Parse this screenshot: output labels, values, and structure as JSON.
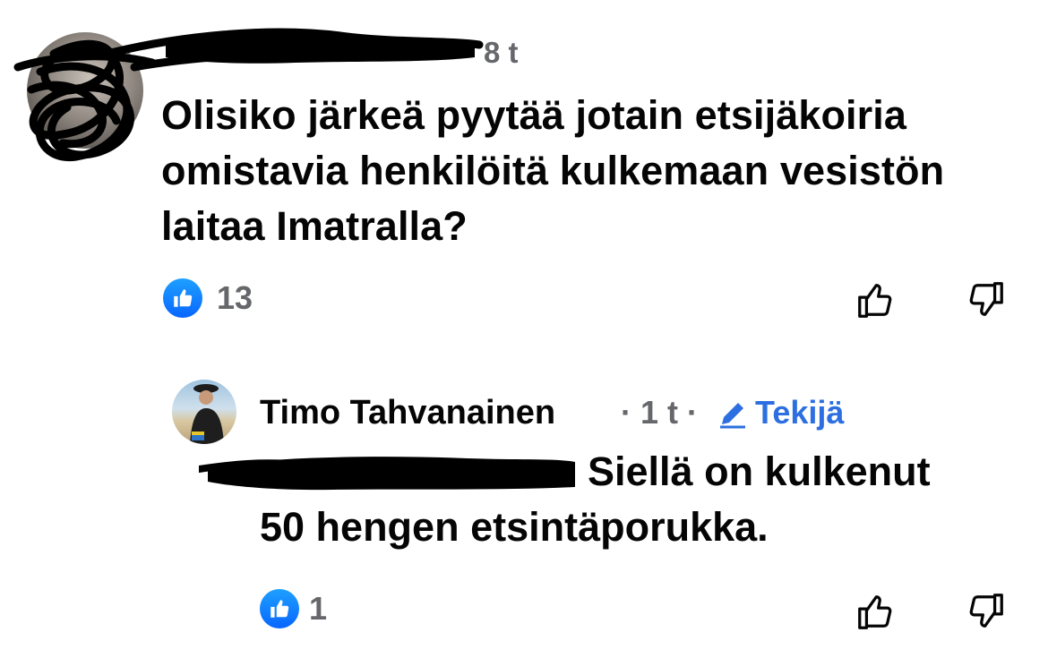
{
  "comment": {
    "author_hidden": true,
    "timestamp": "8 t",
    "text": "Olisiko järkeä pyytää jotain etsijäkoiria omistavia henkilöitä kulkemaan vesistön laitaa Imatralla?",
    "likes": "13",
    "icons": {
      "reaction": "thumbs-up-badge-icon",
      "like": "thumbs-up-outline-icon",
      "dislike": "thumbs-down-outline-icon"
    }
  },
  "reply": {
    "author": "Timo Tahvanainen",
    "meta": "· 1 t ·",
    "author_badge": "Tekijä",
    "mention_hidden": true,
    "text_line1": "Siellä on kulkenut",
    "text_line2": "50 hengen etsintäporukka.",
    "likes": "1",
    "icons": {
      "badge": "pencil-icon",
      "reaction": "thumbs-up-badge-icon",
      "like": "thumbs-up-outline-icon",
      "dislike": "thumbs-down-outline-icon"
    }
  },
  "colors": {
    "text": "#050505",
    "secondary": "#65676b",
    "accent": "#2d6fe0",
    "like_badge": "#0866ff",
    "redaction": "#000000"
  }
}
